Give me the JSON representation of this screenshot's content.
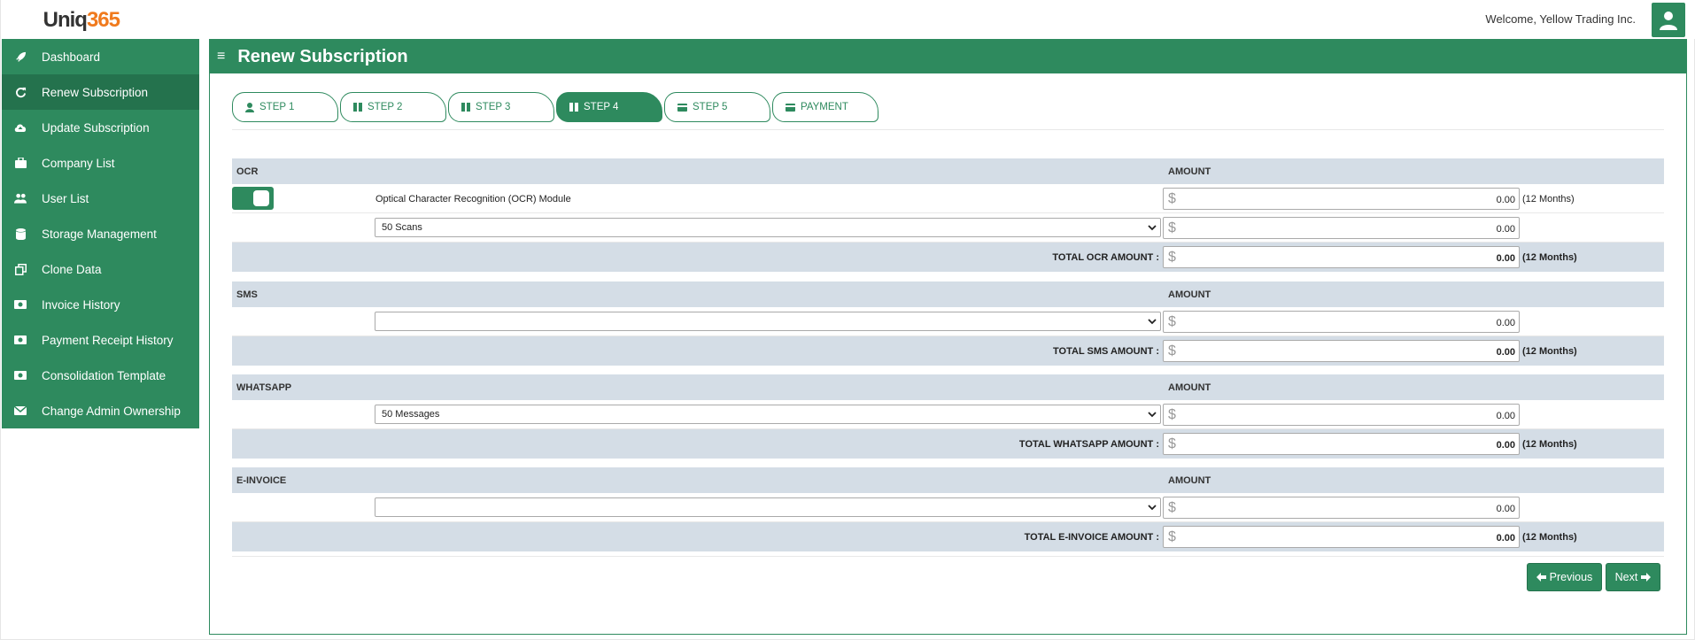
{
  "app": {
    "logo_prefix": "Uniq",
    "logo_number": "365",
    "welcome": "Welcome, Yellow Trading Inc."
  },
  "sidebar": {
    "items": [
      {
        "label": "Dashboard",
        "icon": "rocket-icon"
      },
      {
        "label": "Renew Subscription",
        "icon": "refresh-icon",
        "active": true
      },
      {
        "label": "Update Subscription",
        "icon": "cloud-upload-icon"
      },
      {
        "label": "Company List",
        "icon": "briefcase-icon"
      },
      {
        "label": "User List",
        "icon": "users-icon"
      },
      {
        "label": "Storage Management",
        "icon": "database-icon"
      },
      {
        "label": "Clone Data",
        "icon": "copy-icon"
      },
      {
        "label": "Invoice History",
        "icon": "money-icon"
      },
      {
        "label": "Payment Receipt History",
        "icon": "money-icon"
      },
      {
        "label": "Consolidation Template",
        "icon": "money-icon"
      },
      {
        "label": "Change Admin Ownership",
        "icon": "envelope-icon"
      }
    ]
  },
  "page": {
    "title": "Renew Subscription"
  },
  "steps": [
    {
      "label": "STEP 1",
      "icon": "user-icon"
    },
    {
      "label": "STEP 2",
      "icon": "columns-icon"
    },
    {
      "label": "STEP 3",
      "icon": "columns-icon"
    },
    {
      "label": "STEP 4",
      "icon": "columns-icon",
      "active": true
    },
    {
      "label": "STEP 5",
      "icon": "credit-card-icon"
    },
    {
      "label": "PAYMENT",
      "icon": "credit-card-icon"
    }
  ],
  "sections": {
    "ocr": {
      "title": "OCR",
      "amount_header": "AMOUNT",
      "toggle_on": true,
      "module_label": "Optical Character Recognition (OCR) Module",
      "module_amount": "0.00",
      "module_period": "(12 Months)",
      "select_value": "50 Scans",
      "select_amount": "0.00",
      "total_label": "TOTAL OCR AMOUNT :",
      "total_amount": "0.00",
      "total_period": "(12 Months)"
    },
    "sms": {
      "title": "SMS",
      "amount_header": "AMOUNT",
      "select_value": "",
      "select_amount": "0.00",
      "total_label": "TOTAL SMS AMOUNT :",
      "total_amount": "0.00",
      "total_period": "(12 Months)"
    },
    "whatsapp": {
      "title": "WHATSAPP",
      "amount_header": "AMOUNT",
      "select_value": "50 Messages",
      "select_amount": "0.00",
      "total_label": "TOTAL WHATSAPP AMOUNT :",
      "total_amount": "0.00",
      "total_period": "(12 Months)"
    },
    "einvoice": {
      "title": "E-INVOICE",
      "amount_header": "AMOUNT",
      "select_value": "",
      "select_amount": "0.00",
      "total_label": "TOTAL E-INVOICE AMOUNT :",
      "total_amount": "0.00",
      "total_period": "(12 Months)"
    }
  },
  "currency_symbol": "$",
  "buttons": {
    "previous": "Previous",
    "next": "Next"
  },
  "colors": {
    "primary": "#2e8a5e",
    "primary_dark": "#24724d",
    "section_header_bg": "#d4dde6",
    "logo_accent": "#f07a1d"
  }
}
